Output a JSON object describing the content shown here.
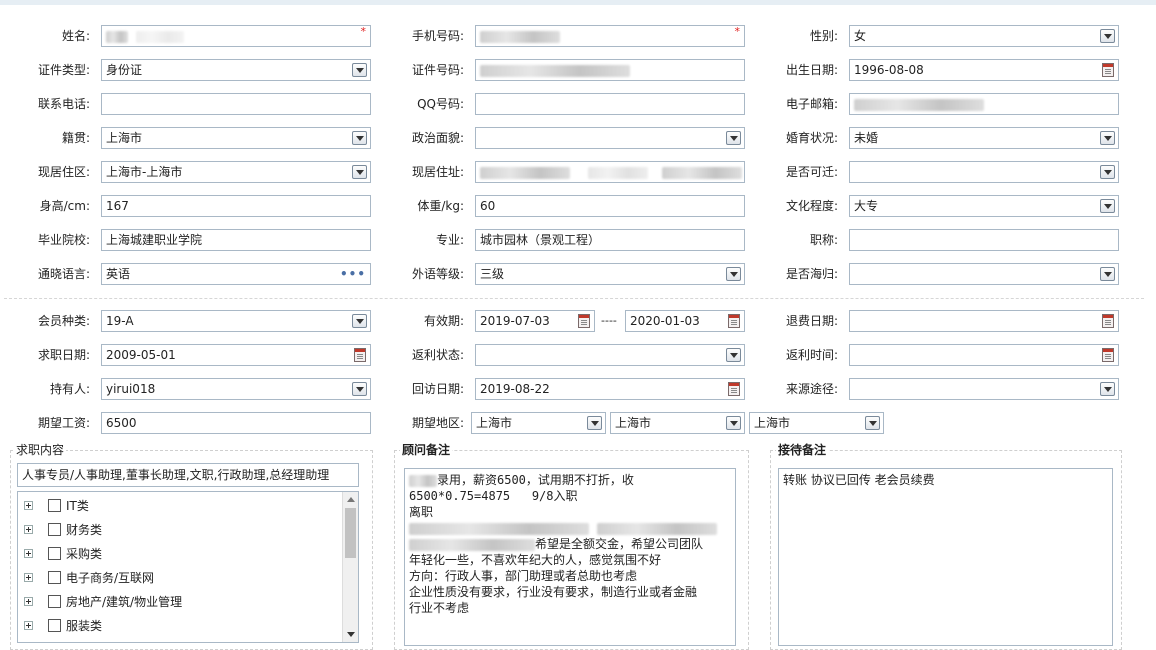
{
  "labels": {
    "name": "姓名:",
    "mobile": "手机号码:",
    "gender": "性别:",
    "id_type": "证件类型:",
    "id_no": "证件号码:",
    "birth": "出生日期:",
    "phone": "联系电话:",
    "qq": "QQ号码:",
    "email": "电子邮箱:",
    "native": "籍贯:",
    "political": "政治面貌:",
    "marital": "婚育状况:",
    "residence": "现居住区:",
    "address": "现居住址:",
    "relocate": "是否可迁:",
    "height": "身高/cm:",
    "weight": "体重/kg:",
    "education": "文化程度:",
    "school": "毕业院校:",
    "major": "专业:",
    "title": "职称:",
    "language": "通晓语言:",
    "lang_level": "外语等级:",
    "overseas": "是否海归:",
    "member_type": "会员种类:",
    "validity": "有效期:",
    "refund_date": "退费日期:",
    "job_date": "求职日期:",
    "rebate_status": "返利状态:",
    "rebate_time": "返利时间:",
    "holder": "持有人:",
    "visit_date": "回访日期:",
    "source": "来源途径:",
    "salary": "期望工资:",
    "region": "期望地区:"
  },
  "values": {
    "gender": "女",
    "id_type": "身份证",
    "birth": "1996-08-08",
    "native": "上海市",
    "marital": "未婚",
    "residence": "上海市-上海市",
    "height": "167",
    "weight": "60",
    "education": "大专",
    "school": "上海城建职业学院",
    "major": "城市园林（景观工程）",
    "language": "英语",
    "lang_level": "三级",
    "member_type": "19-A",
    "valid_from": "2019-07-03",
    "valid_sep": "----",
    "valid_to": "2020-01-03",
    "job_date": "2009-05-01",
    "holder": "yirui018",
    "visit_date": "2019-08-22",
    "salary": "6500",
    "region1": "上海市",
    "region2": "上海市",
    "region3": "上海市"
  },
  "job_section": {
    "legend": "求职内容",
    "selected": "人事专员/人事助理,董事长助理,文职,行政助理,总经理助理",
    "categories": [
      "IT类",
      "财务类",
      "采购类",
      "电子商务/互联网",
      "房地产/建筑/物业管理",
      "服装类"
    ]
  },
  "advisor_section": {
    "legend": "顾问备注",
    "lines": [
      "录用，薪资6500，试用期不打折，收",
      "6500*0.75=4875   9/8入职",
      "离职",
      "",
      "希望是全额交金，希望公司团队",
      "年轻化一些，不喜欢年纪大的人，感觉氛围不好",
      "方向：行政人事，部门助理或者总助也考虑",
      "企业性质没有要求，行业没有要求，制造行业或者金融",
      "行业不考虑"
    ]
  },
  "reception_section": {
    "legend": "接待备注",
    "text": "转账 协议已回传 老会员续费"
  },
  "required_mark": "*",
  "more_dots": "•••"
}
